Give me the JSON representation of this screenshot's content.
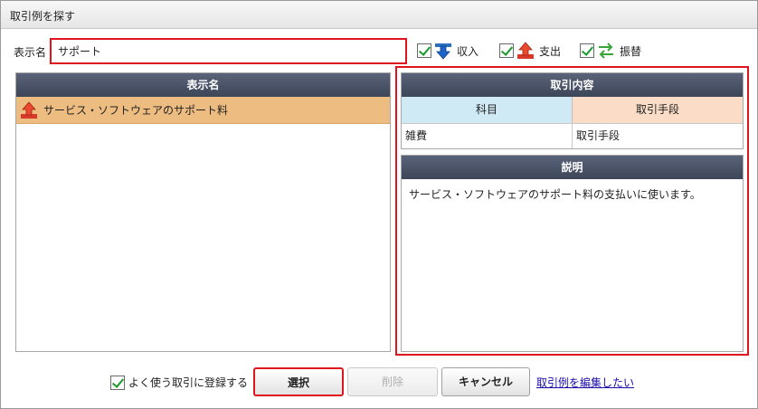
{
  "dialog": {
    "title": "取引例を探す"
  },
  "search": {
    "label": "表示名",
    "value": "サポート"
  },
  "filters": [
    {
      "label": "収入",
      "checked": true,
      "icon": "income-arrow-icon"
    },
    {
      "label": "支出",
      "checked": true,
      "icon": "expense-arrow-icon"
    },
    {
      "label": "振替",
      "checked": true,
      "icon": "transfer-arrows-icon"
    }
  ],
  "list": {
    "header": "表示名",
    "items": [
      {
        "label": "サービス・ソフトウェアのサポート料",
        "icon": "expense-arrow-icon"
      }
    ]
  },
  "detail": {
    "header": "取引内容",
    "col_account": "科目",
    "col_method": "取引手段",
    "account_value": "雑費",
    "method_value": "取引手段"
  },
  "description": {
    "header": "説明",
    "text": "サービス・ソフトウェアのサポート料の支払いに使います。"
  },
  "footer": {
    "favorite_label": "よく使う取引に登録する",
    "select_label": "選択",
    "delete_label": "削除",
    "cancel_label": "キャンセル",
    "edit_link": "取引例を編集したい"
  },
  "colors": {
    "highlight_red": "#e0141e",
    "selected_row": "#edbc80",
    "header_dark": "#4a5266",
    "col_account_bg": "#cfeaf5",
    "col_method_bg": "#fbdcc6"
  }
}
